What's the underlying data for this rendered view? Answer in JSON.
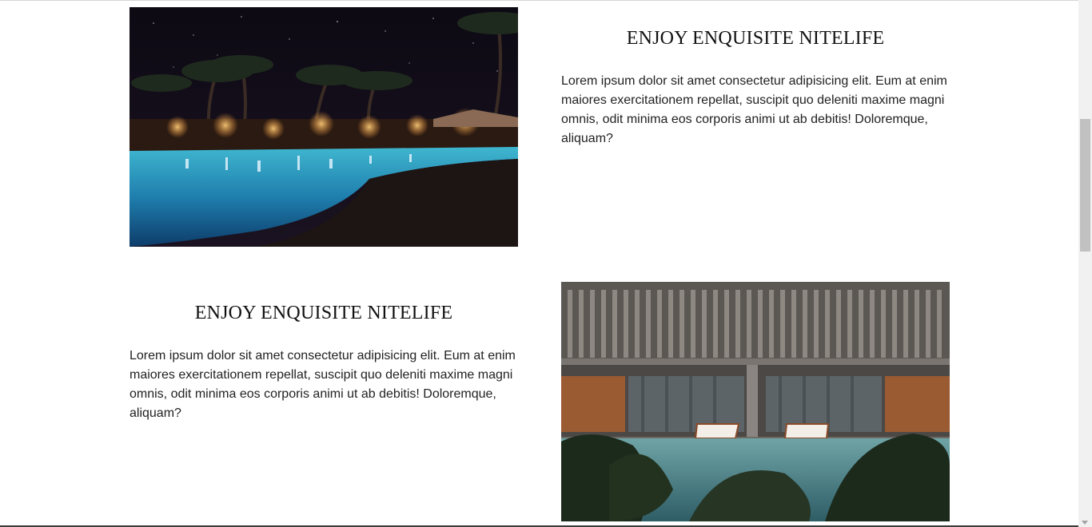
{
  "sections": [
    {
      "image": "night-pool-resort-photo",
      "title": "ENJOY ENQUISITE NITELIFE",
      "body": "Lorem ipsum dolor sit amet consectetur adipisicing elit. Eum at enim maiores exercitationem repellat, suscipit quo deleniti maxime magni omnis, odit minima eos corporis animi ut ab debitis! Doloremque, aliquam?"
    },
    {
      "image": "hotel-pool-loungers-photo",
      "title": "ENJOY ENQUISITE NITELIFE",
      "body": "Lorem ipsum dolor sit amet consectetur adipisicing elit. Eum at enim maiores exercitationem repellat, suscipit quo deleniti maxime magni omnis, odit minima eos corporis animi ut ab debitis! Doloremque, aliquam?"
    }
  ],
  "colors": {
    "title": "#111111",
    "body_text": "#222222",
    "scrollbar_track": "#f1f1f1",
    "scrollbar_thumb": "#c1c1c1"
  }
}
